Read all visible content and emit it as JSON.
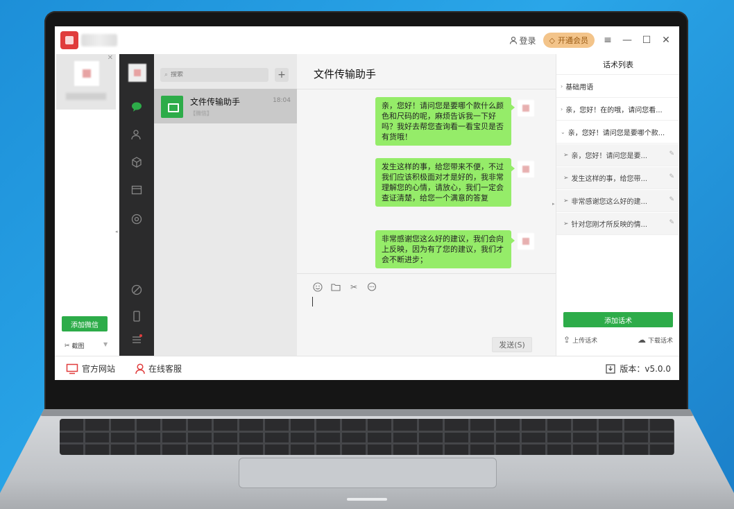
{
  "titlebar": {
    "login_label": "登录",
    "vip_label": "开通会员"
  },
  "account": {
    "add_wechat_label": "添加微信",
    "screenshot_label": "截图"
  },
  "chat_list": {
    "search_placeholder": "搜索",
    "add_symbol": "+",
    "items": [
      {
        "name": "文件传输助手",
        "time": "18:04",
        "preview": "【微信】"
      }
    ]
  },
  "chat": {
    "title": "文件传输助手",
    "messages": [
      "亲，您好！请问您是要哪个款什么颜色和尺码的呢，麻烦告诉我一下好吗？我好去帮您查询看一看宝贝是否有货哦！",
      "发生这样的事，给您带来不便，不过我们应该积极面对才是好的，我非常理解您的心情，请放心，我们一定会查证清楚，给您一个满意的答复",
      "非常感谢您这么好的建议，我们会向上反映，因为有了您的建议，我们才会不断进步；"
    ],
    "send_label": "发送(S)"
  },
  "phrases": {
    "title": "话术列表",
    "groups": [
      {
        "label": "基础用语",
        "arrow": "›"
      },
      {
        "label": "亲，您好！在的哦，请问您看...",
        "arrow": "›"
      },
      {
        "label": "亲，您好！请问您是要哪个款...",
        "arrow": "⌄"
      }
    ],
    "subitems": [
      "亲，您好！请问您是要...",
      "发生这样的事，给您带...",
      "非常感谢您这么好的建...",
      "针对您刚才所反映的情..."
    ],
    "add_label": "添加话术",
    "upload_label": "上传话术",
    "download_label": "下载话术"
  },
  "bottom": {
    "official_site": "官方网站",
    "online_service": "在线客服",
    "version": "版本：v5.0.0"
  },
  "colors": {
    "accent_green": "#2dac49",
    "bubble_green": "#95ec69",
    "vip_gold": "#f3c48a",
    "brand_red": "#e03c3c"
  }
}
